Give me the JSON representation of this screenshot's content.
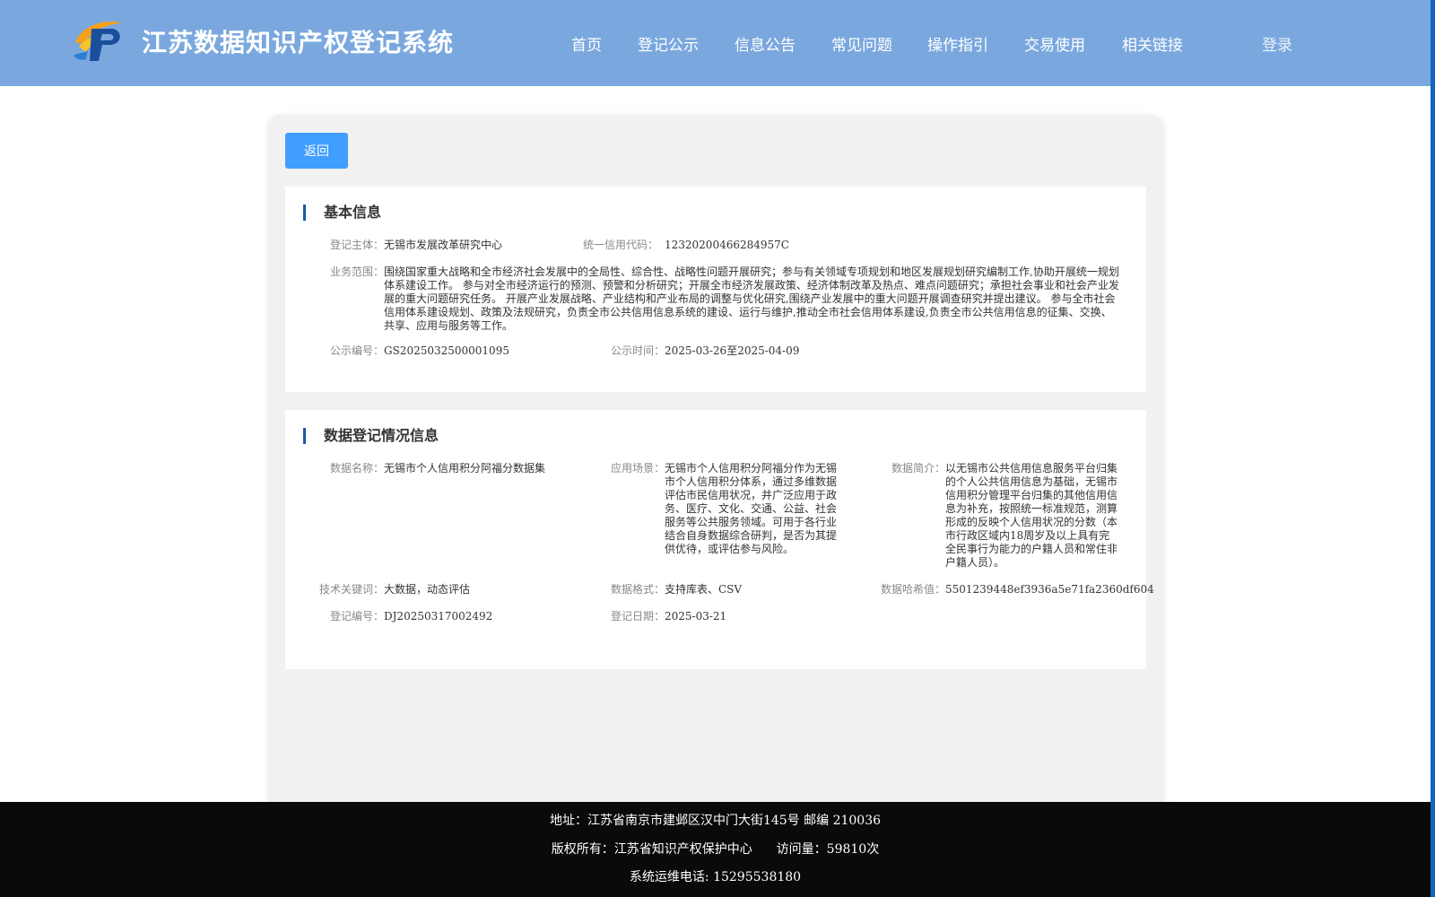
{
  "header": {
    "title": "江苏数据知识产权登记系统",
    "logo_icon": "jiangsu-ip-logo",
    "nav": [
      "首页",
      "登记公示",
      "信息公告",
      "常见问题",
      "操作指引",
      "交易使用",
      "相关链接"
    ],
    "login_label": "登录"
  },
  "back_label": "返回",
  "basic": {
    "title": "基本信息",
    "subject_label": "登记主体：",
    "subject_value": "无锡市发展改革研究中心",
    "credit_code_label": "统一信用代码：",
    "credit_code_value": "12320200466284957C",
    "scope_label": "业务范围：",
    "scope_value": "围绕国家重大战略和全市经济社会发展中的全局性、综合性、战略性问题开展研究；参与有关领域专项规划和地区发展规划研究编制工作,协助开展统一规划体系建设工作。 参与对全市经济运行的预测、预警和分析研究；开展全市经济发展政策、经济体制改革及热点、难点问题研究；承担社会事业和社会产业发展的重大问题研究任务。 开展产业发展战略、产业结构和产业布局的调整与优化研究,围绕产业发展中的重大问题开展调查研究并提出建议。 参与全市社会信用体系建设规划、政策及法规研究，负责全市公共信用信息系统的建设、运行与维护,推动全市社会信用体系建设,负责全市公共信用信息的征集、交换、共享、应用与服务等工作。",
    "pub_no_label": "公示编号：",
    "pub_no_value": "GS2025032500001095",
    "pub_time_label": "公示时间：",
    "pub_time_value": "2025-03-26至2025-04-09"
  },
  "data_info": {
    "title": "数据登记情况信息",
    "name_label": "数据名称：",
    "name_value": "无锡市个人信用积分阿福分数据集",
    "scene_label": "应用场景：",
    "scene_value": "无锡市个人信用积分阿福分作为无锡市个人信用积分体系，通过多维数据评估市民信用状况，并广泛应用于政务、医疗、文化、交通、公益、社会服务等公共服务领域。可用于各行业结合自身数据综合研判，是否为其提供优待，或评估参与风险。",
    "intro_label": "数据简介：",
    "intro_value": "以无锡市公共信用信息服务平台归集的个人公共信用信息为基础，无锡市信用积分管理平台归集的其他信用信息为补充，按照统一标准规范，测算形成的反映个人信用状况的分数（本市行政区域内18周岁及以上具有完全民事行为能力的户籍人员和常住非户籍人员）。",
    "keywords_label": "技术关键词：",
    "keywords_value": "大数据，动态评估",
    "format_label": "数据格式：",
    "format_value": "支持库表、CSV",
    "hash_label": "数据哈希值：",
    "hash_value": "5501239448ef3936a5e71fa2360df604",
    "reg_no_label": "登记编号：",
    "reg_no_value": "DJ20250317002492",
    "reg_date_label": "登记日期：",
    "reg_date_value": "2025-03-21"
  },
  "footer": {
    "address": "地址：江苏省南京市建邺区汉中门大街145号 邮编 210036",
    "copyright": "版权所有：江苏省知识产权保护中心",
    "visits": "访问量：59810次",
    "phone": "系统运维电话: 15295538180"
  },
  "colors": {
    "header_bg": "#7aa8de",
    "button_blue": "#409eff",
    "title_bar": "#1a5aa8",
    "footer_bg": "#0a0a0a"
  }
}
